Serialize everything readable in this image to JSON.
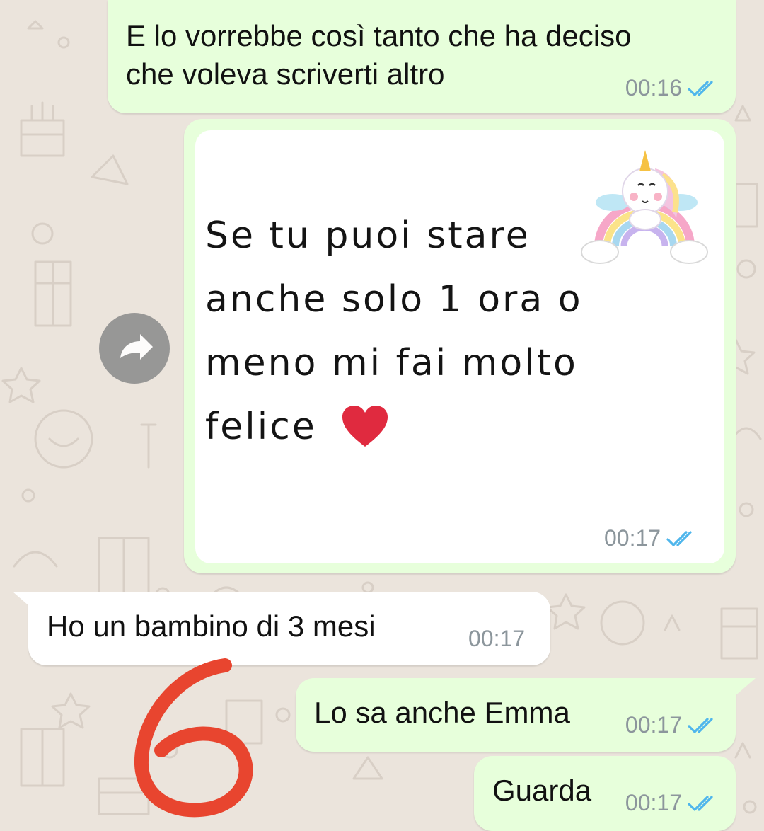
{
  "colors": {
    "outgoing_bubble": "#e7ffdb",
    "incoming_bubble": "#ffffff",
    "read_ticks": "#4fb6ec",
    "timestamp": "#8c969c",
    "annotation_red": "#e8452f",
    "heart": "#e02a3f"
  },
  "messages": [
    {
      "direction": "outgoing",
      "text": "E lo vorrebbe così tanto che ha deciso\nche voleva scriverti altro",
      "time": "00:16",
      "status": "read"
    },
    {
      "direction": "outgoing",
      "type": "image",
      "image_text": "Se tu puoi stare anche solo 1 ora o meno mi fai molto felice",
      "image_text_lines": [
        "Se tu puoi stare",
        "anche solo 1 ora o",
        "meno mi fai molto",
        "felice"
      ],
      "image_decorations": [
        "unicorn-sticker",
        "heart-emoji"
      ],
      "time": "00:17",
      "status": "read"
    },
    {
      "direction": "incoming",
      "text": "Ho un bambino di 3 mesi",
      "time": "00:17"
    },
    {
      "direction": "outgoing",
      "text": "Lo sa anche Emma",
      "time": "00:17",
      "status": "read"
    },
    {
      "direction": "outgoing",
      "text": "Guarda",
      "time": "00:17",
      "status": "read"
    }
  ],
  "forward_icon": "forward-arrow-icon",
  "annotation": {
    "text": "6",
    "style": "hand-drawn red number"
  }
}
